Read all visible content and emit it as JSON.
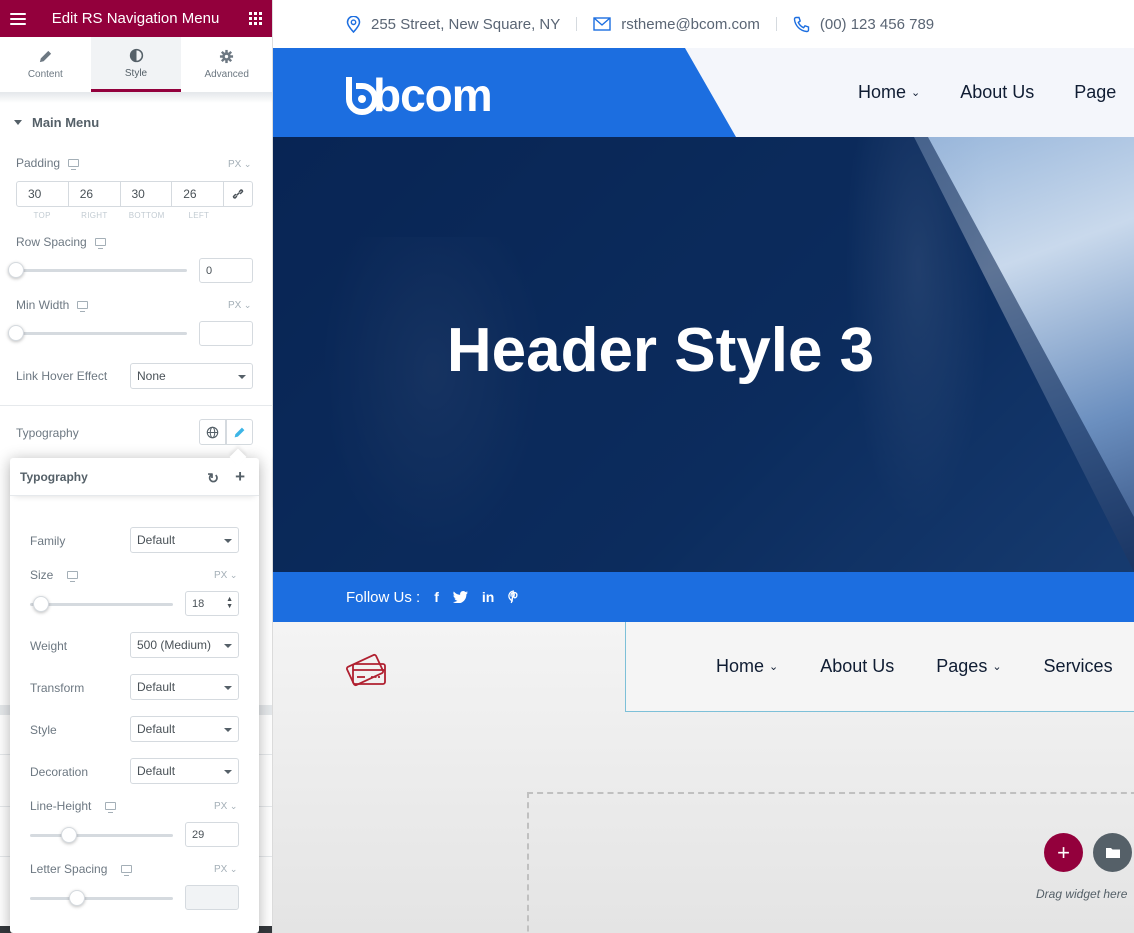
{
  "panel": {
    "title": "Edit RS Navigation Menu",
    "tabs": [
      {
        "label": "Content",
        "icon": "pencil-icon"
      },
      {
        "label": "Style",
        "icon": "contrast-icon"
      },
      {
        "label": "Advanced",
        "icon": "gear-icon"
      }
    ],
    "active_tab": "Style",
    "section_title": "Main Menu",
    "padding": {
      "label": "Padding",
      "unit": "PX",
      "values": [
        "30",
        "26",
        "30",
        "26"
      ],
      "sides": [
        "TOP",
        "RIGHT",
        "BOTTOM",
        "LEFT"
      ]
    },
    "row_spacing": {
      "label": "Row Spacing",
      "value": "0"
    },
    "min_width": {
      "label": "Min Width",
      "unit": "PX",
      "value": ""
    },
    "link_hover": {
      "label": "Link Hover Effect",
      "value": "None"
    },
    "typography_label": "Typography"
  },
  "typography_popover": {
    "title": "Typography",
    "family": {
      "label": "Family",
      "value": "Default"
    },
    "size": {
      "label": "Size",
      "unit": "PX",
      "value": "18"
    },
    "weight": {
      "label": "Weight",
      "value": "500 (Medium)"
    },
    "transform": {
      "label": "Transform",
      "value": "Default"
    },
    "style": {
      "label": "Style",
      "value": "Default"
    },
    "decoration": {
      "label": "Decoration",
      "value": "Default"
    },
    "line_height": {
      "label": "Line-Height",
      "unit": "PX",
      "value": "29"
    },
    "letter_spacing": {
      "label": "Letter Spacing",
      "unit": "PX",
      "value": ""
    }
  },
  "preview": {
    "topbar": {
      "address": "255 Street, New Square, NY",
      "email": "rstheme@bcom.com",
      "phone": "(00) 123 456 789"
    },
    "logo": "bcom",
    "nav": [
      "Home",
      "About Us",
      "Page"
    ],
    "hero_title": "Header Style 3",
    "follow_label": "Follow Us :",
    "social": [
      "facebook-icon",
      "twitter-icon",
      "linkedin-icon",
      "pinterest-icon"
    ],
    "nav2": [
      "Home",
      "About Us",
      "Pages",
      "Services"
    ],
    "drag_text": "Drag widget here"
  },
  "colors": {
    "panel_accent": "#93003c",
    "brand_blue": "#1c6ee0",
    "hero_navy": "#0d2b5c",
    "folder_button": "#556068"
  }
}
